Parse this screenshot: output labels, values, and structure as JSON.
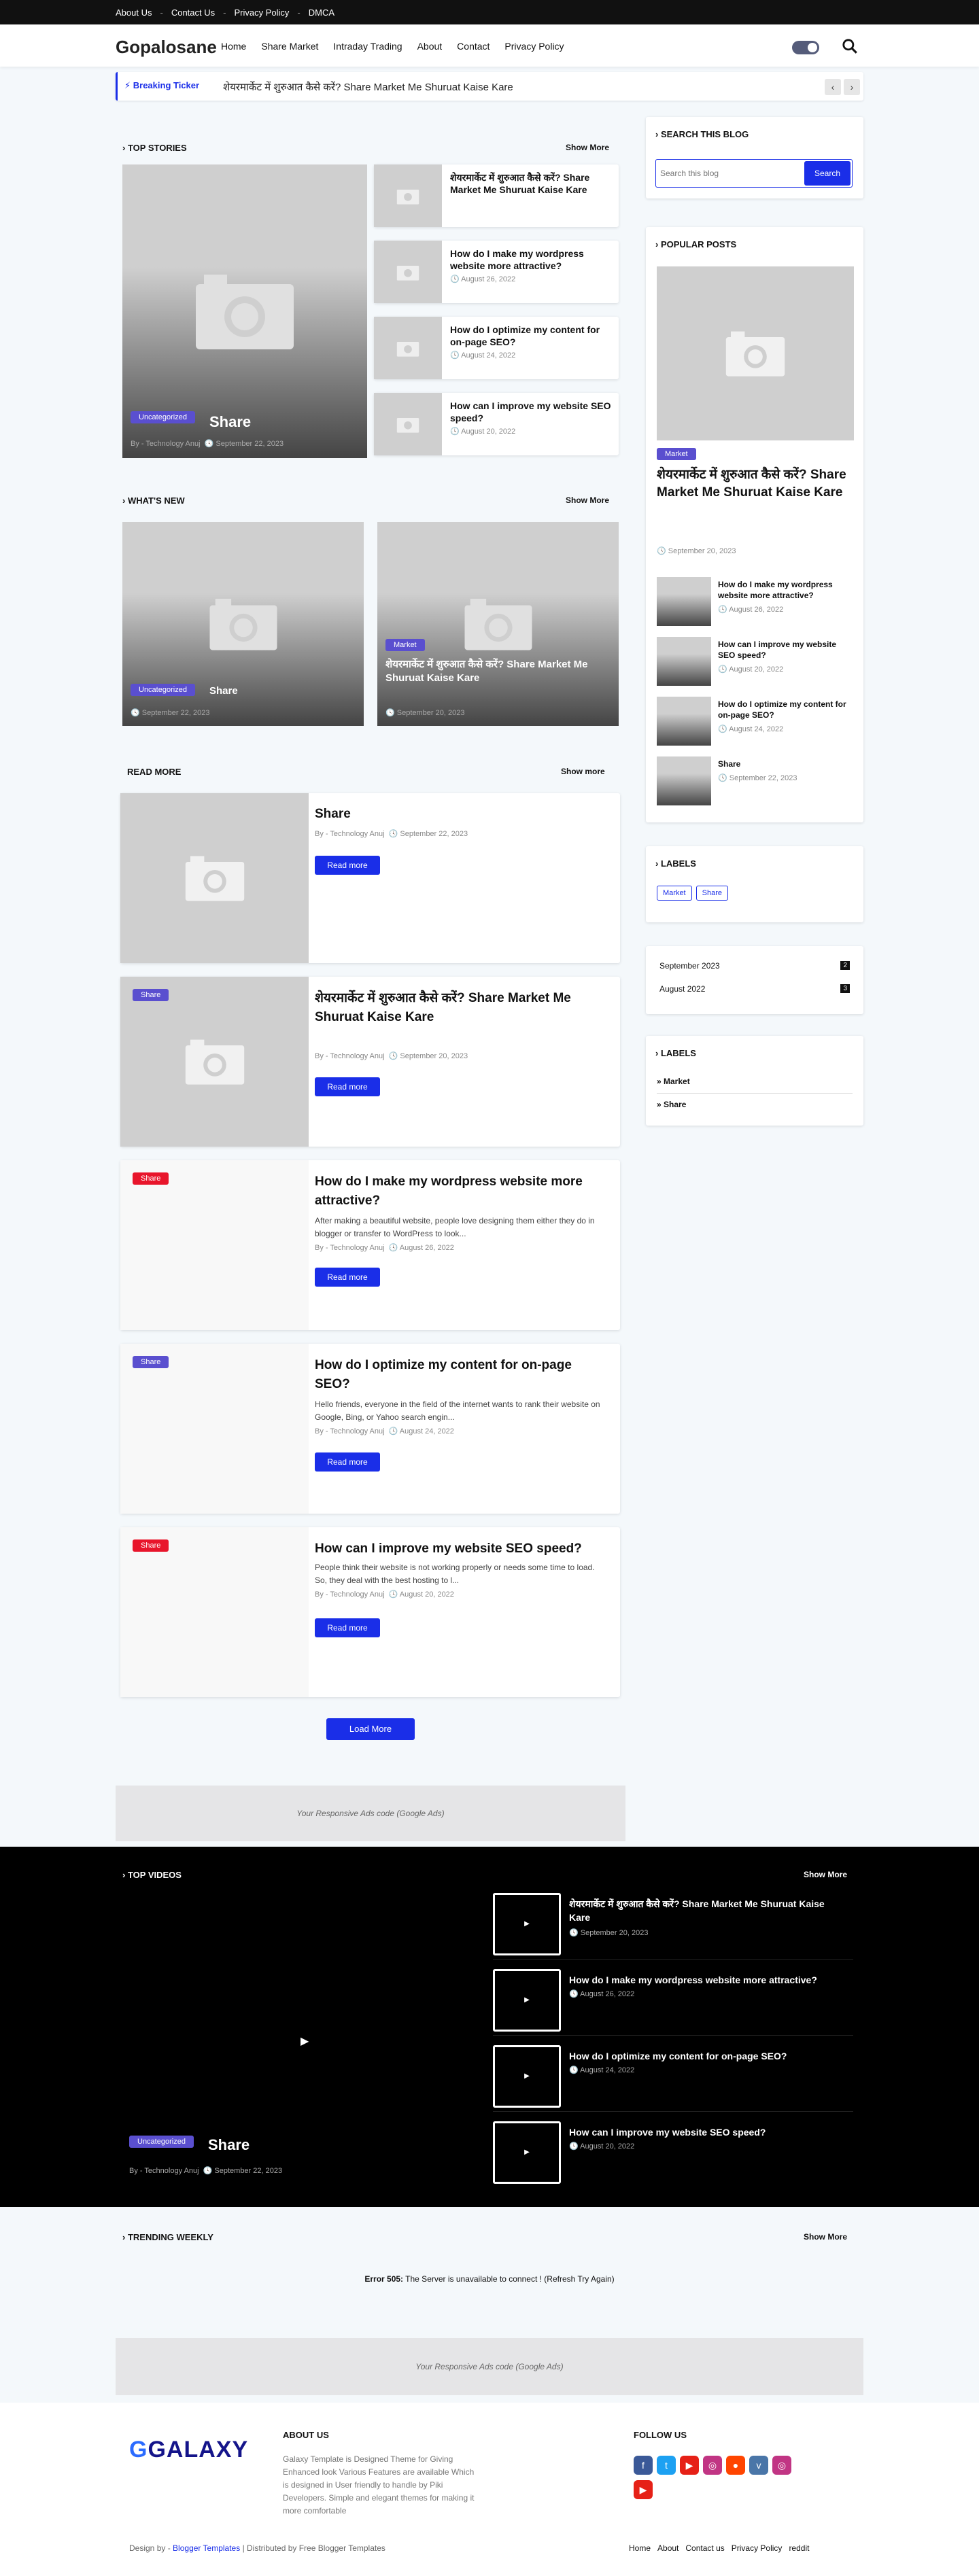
{
  "topbar": {
    "links": [
      "About Us",
      "Contact Us",
      "Privacy Policy",
      "DMCA"
    ]
  },
  "header": {
    "logo": "Gopalosane",
    "nav": [
      "Home",
      "Share Market",
      "Intraday Trading",
      "About",
      "Contact",
      "Privacy Policy"
    ]
  },
  "ticker": {
    "label": "Breaking Ticker",
    "text": "शेयरमार्केट में शुरुआत कैसे करें? Share Market Me Shuruat Kaise Kare"
  },
  "top_stories": {
    "title": "TOP STORIES",
    "show_more": "Show More",
    "main": {
      "badge": "Uncategorized",
      "title": "Share",
      "author": "By - Technology Anuj",
      "date": "September 22, 2023"
    },
    "list": [
      {
        "title": "शेयरमार्केट में शुरुआत कैसे करें? Share Market Me Shuruat Kaise Kare",
        "date": ""
      },
      {
        "title": "How do I make my wordpress website more attractive?",
        "date": "August 26, 2022"
      },
      {
        "title": "How do I optimize my content for on-page SEO?",
        "date": "August 24, 2022"
      },
      {
        "title": "How can I improve my website SEO speed?",
        "date": "August 20, 2022"
      }
    ]
  },
  "whats_new": {
    "title": "WHAT'S NEW",
    "show_more": "Show More",
    "items": [
      {
        "badge": "Uncategorized",
        "title": "Share",
        "date": "September 22, 2023"
      },
      {
        "badge": "Market",
        "title": "शेयरमार्केट में शुरुआत कैसे करें? Share Market Me Shuruat Kaise Kare",
        "date": "September 20, 2023"
      }
    ]
  },
  "read_more": {
    "title": "READ MORE",
    "show_more": "Show more",
    "button": "Read more",
    "load_more": "Load More",
    "posts": [
      {
        "badge": "",
        "title": "Share",
        "excerpt": "",
        "author": "By - Technology Anuj",
        "date": "September 22, 2023"
      },
      {
        "badge": "Share",
        "title": "शेयरमार्केट में शुरुआत कैसे करें? Share Market Me Shuruat Kaise Kare",
        "excerpt": "",
        "author": "By - Technology Anuj",
        "date": "September 20, 2023"
      },
      {
        "badge": "Share",
        "title": "How do I make my wordpress website more attractive?",
        "excerpt": "After making a beautiful website, people love designing them either they do in blogger or transfer to WordPress to look...",
        "author": "By - Technology Anuj",
        "date": "August 26, 2022"
      },
      {
        "badge": "Share",
        "title": "How do I optimize my content for on-page SEO?",
        "excerpt": "Hello friends, everyone in the field of the internet wants to rank their website on Google, Bing, or Yahoo search engin...",
        "author": "By - Technology Anuj",
        "date": "August 24, 2022"
      },
      {
        "badge": "Share",
        "title": "How can I improve my website SEO speed?",
        "excerpt": "People think their website is not working properly or needs some time to load. So, they deal with the best hosting to l...",
        "author": "By - Technology Anuj",
        "date": "August 20, 2022"
      }
    ]
  },
  "ads": {
    "text": "Your Responsive Ads code (Google Ads)"
  },
  "sidebar": {
    "search": {
      "title": "SEARCH THIS BLOG",
      "placeholder": "Search this blog",
      "button": "Search"
    },
    "popular": {
      "title": "POPULAR POSTS",
      "main": {
        "badge": "Market",
        "title": "शेयरमार्केट में शुरुआत कैसे करें? Share Market Me Shuruat Kaise Kare",
        "date": "September 20, 2023"
      },
      "list": [
        {
          "title": "How do I make my wordpress website more attractive?",
          "date": "August 26, 2022"
        },
        {
          "title": "How can I improve my website SEO speed?",
          "date": "August 20, 2022"
        },
        {
          "title": "How do I optimize my content for on-page SEO?",
          "date": "August 24, 2022"
        },
        {
          "title": "Share",
          "date": "September 22, 2023"
        }
      ]
    },
    "labels": {
      "title": "LABELS",
      "items": [
        "Market",
        "Share"
      ]
    },
    "archive": {
      "items": [
        {
          "label": "September 2023",
          "count": "2"
        },
        {
          "label": "August 2022",
          "count": "3"
        }
      ]
    },
    "labels2": {
      "title": "LABELS",
      "items": [
        "Market",
        "Share"
      ]
    }
  },
  "videos": {
    "title": "TOP VIDEOS",
    "show_more": "Show More",
    "main": {
      "badge": "Uncategorized",
      "title": "Share",
      "author": "By - Technology Anuj",
      "date": "September 22, 2023"
    },
    "list": [
      {
        "title": "शेयरमार्केट में शुरुआत कैसे करें? Share Market Me Shuruat Kaise Kare",
        "date": "September 20, 2023"
      },
      {
        "title": "How do I make my wordpress website more attractive?",
        "date": "August 26, 2022"
      },
      {
        "title": "How do I optimize my content for on-page SEO?",
        "date": "August 24, 2022"
      },
      {
        "title": "How can I improve my website SEO speed?",
        "date": "August 20, 2022"
      }
    ]
  },
  "trending": {
    "title": "TRENDING WEEKLY",
    "show_more": "Show More",
    "error_bold": "Error 505:",
    "error": "The Server is unavailable to connect ! (Refresh Try Again)"
  },
  "footer": {
    "logo": "GALAXY",
    "about_title": "ABOUT US",
    "about": "Galaxy Template is Designed Theme for Giving Enhanced look Various Features are available Which is designed in User friendly to handle by Piki Developers. Simple and elegant themes for making it more comfortable",
    "follow_title": "FOLLOW US",
    "credit_prefix": "Design by -",
    "credit_link": "Blogger Templates",
    "credit_suffix": "| Distributed by Free Blogger Templates",
    "links": [
      "Home",
      "About",
      "Contact us",
      "Privacy Policy",
      "reddit"
    ]
  },
  "colors": {
    "accent": "#1a2ee8",
    "badge": "#5a4fcf",
    "red": "#e8152b"
  }
}
